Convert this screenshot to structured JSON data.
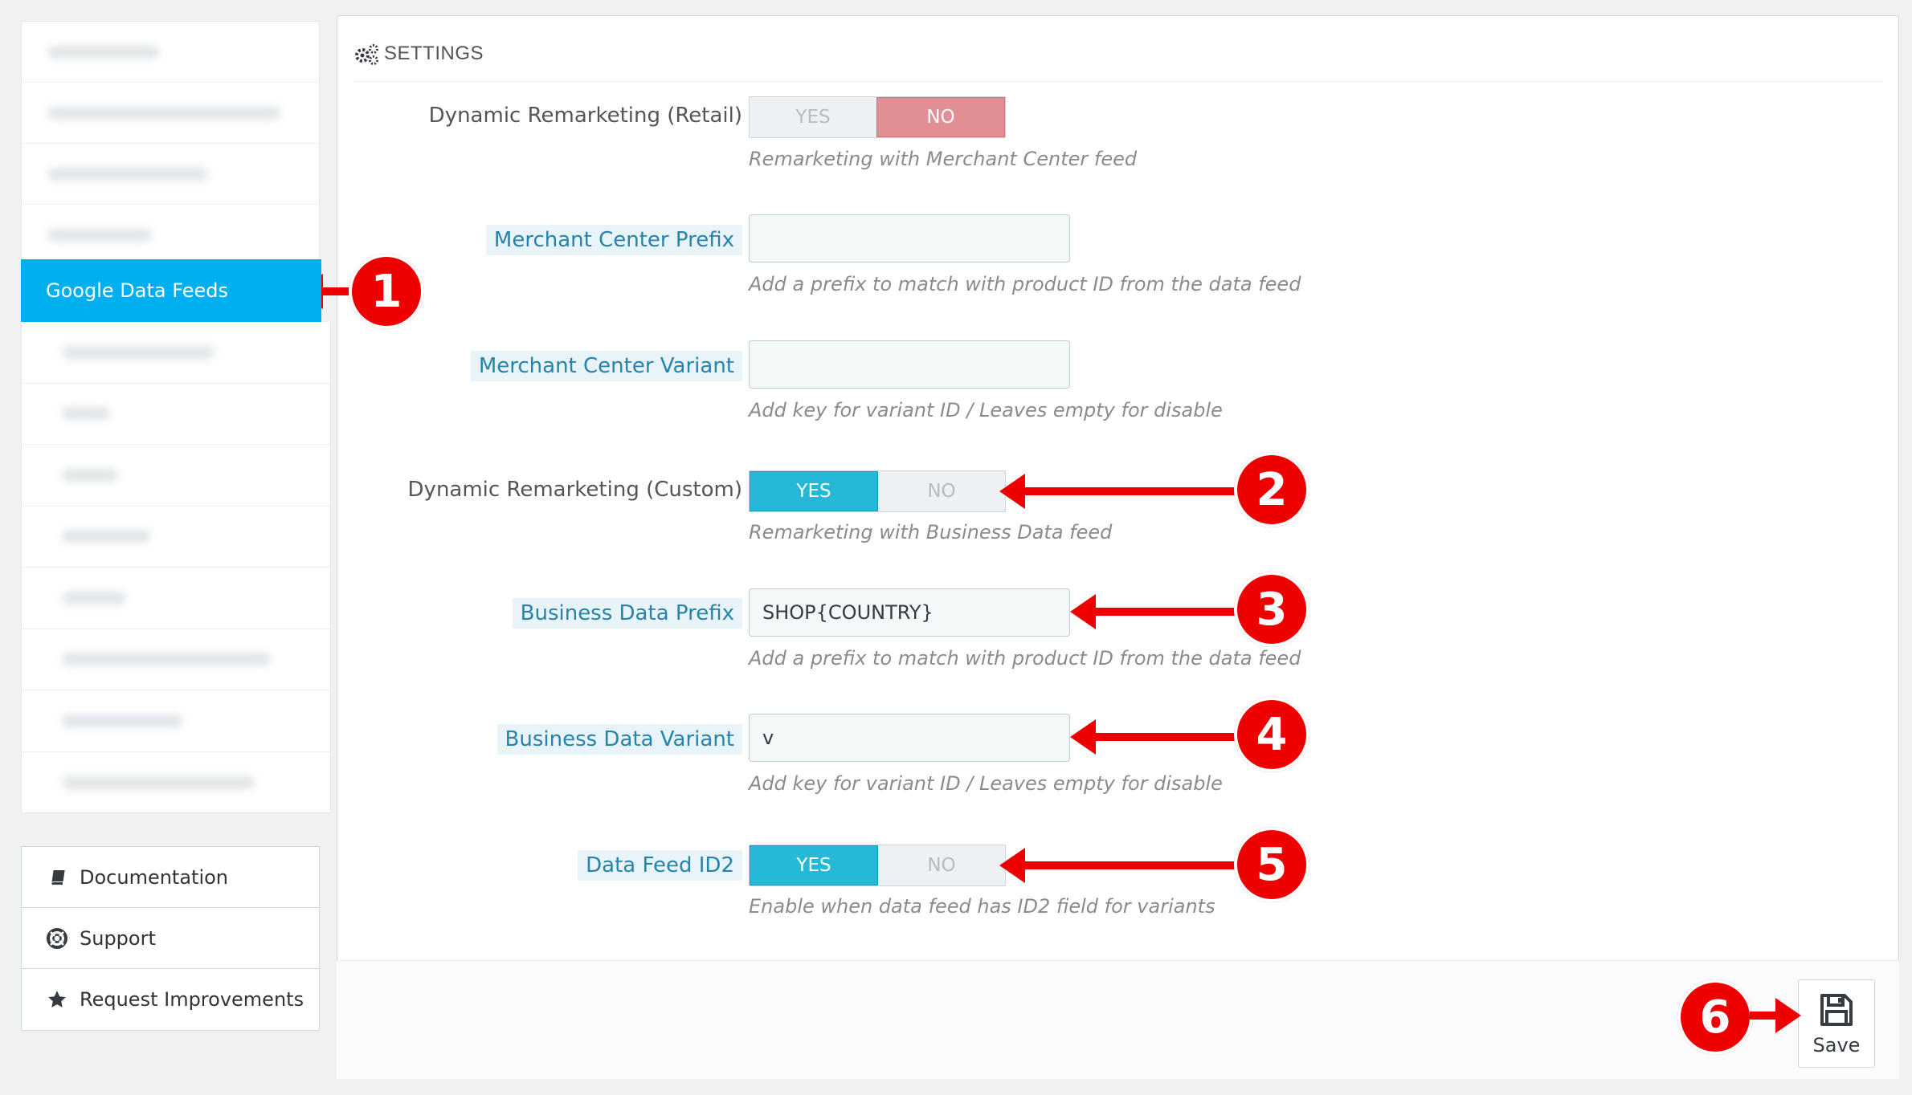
{
  "sidebar": {
    "active_item": "Google Data Feeds",
    "help_links": [
      "Documentation",
      "Support",
      "Request Improvements"
    ]
  },
  "panel": {
    "title": "SETTINGS",
    "rows": [
      {
        "label": "Dynamic Remarketing (Retail)",
        "type": "switch",
        "yes": "YES",
        "no": "NO",
        "selected": "NO",
        "help": "Remarketing with Merchant Center feed"
      },
      {
        "label": "Merchant Center Prefix",
        "type": "input",
        "value": "",
        "help": "Add a prefix to match with product ID from the data feed"
      },
      {
        "label": "Merchant Center Variant",
        "type": "input",
        "value": "",
        "help": "Add key for variant ID / Leaves empty for disable"
      },
      {
        "label": "Dynamic Remarketing (Custom)",
        "type": "switch",
        "yes": "YES",
        "no": "NO",
        "selected": "YES",
        "help": "Remarketing with Business Data feed"
      },
      {
        "label": "Business Data Prefix",
        "type": "input",
        "value": "SHOP{COUNTRY}",
        "help": "Add a prefix to match with product ID from the data feed"
      },
      {
        "label": "Business Data Variant",
        "type": "input",
        "value": "v",
        "help": "Add key for variant ID / Leaves empty for disable"
      },
      {
        "label": "Data Feed ID2",
        "type": "switch",
        "yes": "YES",
        "no": "NO",
        "selected": "YES",
        "help": "Enable when data feed has ID2 field for variants"
      }
    ],
    "save_label": "Save"
  },
  "annotations": [
    "1",
    "2",
    "3",
    "4",
    "5",
    "6"
  ],
  "colors": {
    "active": "#00aff0",
    "switch_yes": "#25b9d7",
    "switch_no": "#e08f95",
    "annotation": "#ee0000",
    "hint": "#2683ab"
  }
}
